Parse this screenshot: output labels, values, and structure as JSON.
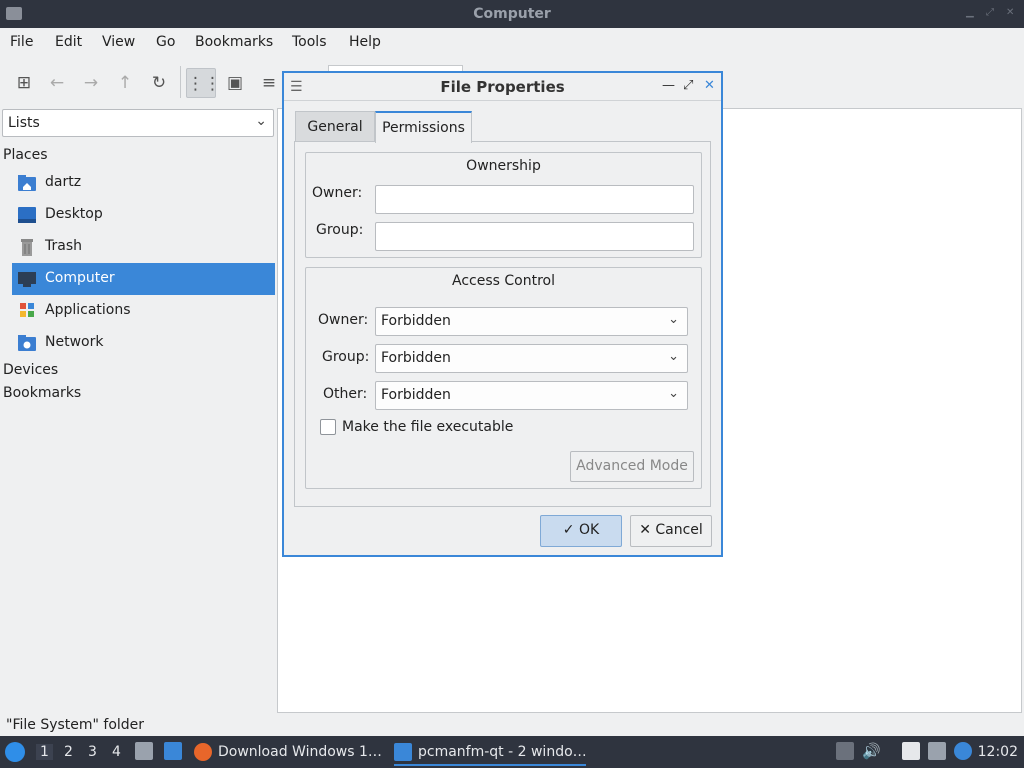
{
  "window": {
    "title": "Computer"
  },
  "menu": [
    "File",
    "Edit",
    "View",
    "Go",
    "Bookmarks",
    "Tools",
    "Help"
  ],
  "toolbar": {
    "icons": [
      "new-tab-icon",
      "back-icon",
      "forward-icon",
      "up-icon",
      "reload-icon",
      "icon-view-icon",
      "thumbnail-view-icon",
      "list-view-icon"
    ]
  },
  "sidebar": {
    "combo_value": "Lists",
    "places_label": "Places",
    "items": [
      {
        "label": "dartz",
        "icon": "home-folder-icon"
      },
      {
        "label": "Desktop",
        "icon": "desktop-icon"
      },
      {
        "label": "Trash",
        "icon": "trash-icon"
      },
      {
        "label": "Computer",
        "icon": "computer-icon",
        "selected": true
      },
      {
        "label": "Applications",
        "icon": "applications-icon"
      },
      {
        "label": "Network",
        "icon": "network-icon"
      }
    ],
    "devices_label": "Devices",
    "bookmarks_label": "Bookmarks"
  },
  "status": {
    "text": "\"File System\" folder"
  },
  "dialog": {
    "title": "File Properties",
    "tabs": [
      "General",
      "Permissions"
    ],
    "active_tab": "Permissions",
    "ownership": {
      "title": "Ownership",
      "owner_label": "Owner:",
      "owner_value": "",
      "group_label": "Group:",
      "group_value": ""
    },
    "access": {
      "title": "Access Control",
      "owner_label": "Owner:",
      "owner_value": "Forbidden",
      "group_label": "Group:",
      "group_value": "Forbidden",
      "other_label": "Other:",
      "other_value": "Forbidden",
      "executable_label": "Make the file executable",
      "executable_checked": false,
      "advanced_label": "Advanced Mode"
    },
    "ok_label": "OK",
    "cancel_label": "Cancel"
  },
  "taskbar": {
    "workspaces": [
      "1",
      "2",
      "3",
      "4"
    ],
    "current_workspace": "1",
    "tasks": [
      {
        "label": "Download Windows 1…",
        "icon": "firefox-icon"
      },
      {
        "label": "pcmanfm-qt - 2 windo…",
        "icon": "folder-icon",
        "active": true
      }
    ],
    "clock": "12:02"
  },
  "colors": {
    "accent": "#3a87d8",
    "panel": "#2f343f",
    "window_bg": "#eff0f1"
  }
}
